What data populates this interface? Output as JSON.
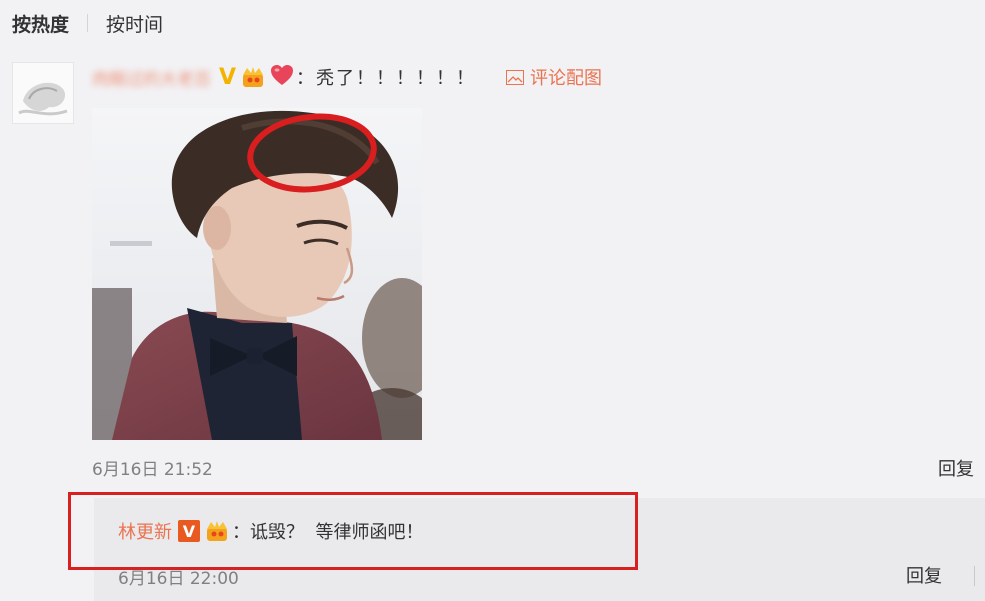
{
  "sort": {
    "hot_label": "按热度",
    "time_label": "按时间"
  },
  "comment": {
    "username": "肉眼过的大老百",
    "text": "：秃了！！！！！！",
    "pic_link": "评论配图",
    "time": "6月16日 21:52",
    "reply_label": "回复"
  },
  "reply": {
    "username": "林更新",
    "v_label": "V",
    "text": "：诋毁？  等律师函吧！",
    "time": "6月16日 22:00",
    "reply_label": "回复"
  },
  "colors": {
    "background": "#f2f2f5",
    "link": "#eb7350",
    "v_badge": "#f4b300",
    "reply_box": "#eaeaec",
    "highlight": "#d82020"
  },
  "icons": [
    "avatar",
    "verified-v-icon",
    "crown-badge-icon",
    "heart-icon",
    "image-icon",
    "verified-box-icon"
  ]
}
